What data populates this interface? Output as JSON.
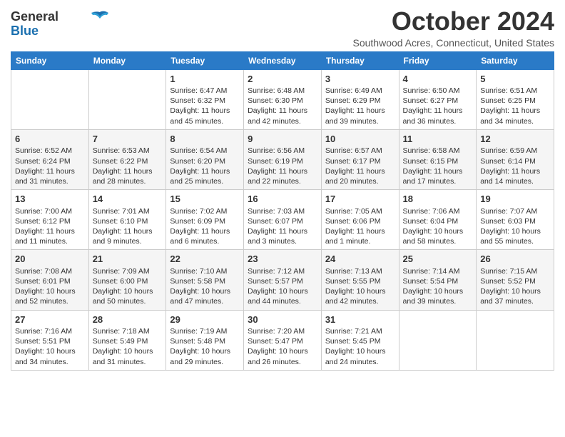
{
  "logo": {
    "general": "General",
    "blue": "Blue"
  },
  "header": {
    "month": "October 2024",
    "location": "Southwood Acres, Connecticut, United States"
  },
  "days_of_week": [
    "Sunday",
    "Monday",
    "Tuesday",
    "Wednesday",
    "Thursday",
    "Friday",
    "Saturday"
  ],
  "weeks": [
    [
      {
        "day": "",
        "info": ""
      },
      {
        "day": "",
        "info": ""
      },
      {
        "day": "1",
        "info": "Sunrise: 6:47 AM\nSunset: 6:32 PM\nDaylight: 11 hours\nand 45 minutes."
      },
      {
        "day": "2",
        "info": "Sunrise: 6:48 AM\nSunset: 6:30 PM\nDaylight: 11 hours\nand 42 minutes."
      },
      {
        "day": "3",
        "info": "Sunrise: 6:49 AM\nSunset: 6:29 PM\nDaylight: 11 hours\nand 39 minutes."
      },
      {
        "day": "4",
        "info": "Sunrise: 6:50 AM\nSunset: 6:27 PM\nDaylight: 11 hours\nand 36 minutes."
      },
      {
        "day": "5",
        "info": "Sunrise: 6:51 AM\nSunset: 6:25 PM\nDaylight: 11 hours\nand 34 minutes."
      }
    ],
    [
      {
        "day": "6",
        "info": "Sunrise: 6:52 AM\nSunset: 6:24 PM\nDaylight: 11 hours\nand 31 minutes."
      },
      {
        "day": "7",
        "info": "Sunrise: 6:53 AM\nSunset: 6:22 PM\nDaylight: 11 hours\nand 28 minutes."
      },
      {
        "day": "8",
        "info": "Sunrise: 6:54 AM\nSunset: 6:20 PM\nDaylight: 11 hours\nand 25 minutes."
      },
      {
        "day": "9",
        "info": "Sunrise: 6:56 AM\nSunset: 6:19 PM\nDaylight: 11 hours\nand 22 minutes."
      },
      {
        "day": "10",
        "info": "Sunrise: 6:57 AM\nSunset: 6:17 PM\nDaylight: 11 hours\nand 20 minutes."
      },
      {
        "day": "11",
        "info": "Sunrise: 6:58 AM\nSunset: 6:15 PM\nDaylight: 11 hours\nand 17 minutes."
      },
      {
        "day": "12",
        "info": "Sunrise: 6:59 AM\nSunset: 6:14 PM\nDaylight: 11 hours\nand 14 minutes."
      }
    ],
    [
      {
        "day": "13",
        "info": "Sunrise: 7:00 AM\nSunset: 6:12 PM\nDaylight: 11 hours\nand 11 minutes."
      },
      {
        "day": "14",
        "info": "Sunrise: 7:01 AM\nSunset: 6:10 PM\nDaylight: 11 hours\nand 9 minutes."
      },
      {
        "day": "15",
        "info": "Sunrise: 7:02 AM\nSunset: 6:09 PM\nDaylight: 11 hours\nand 6 minutes."
      },
      {
        "day": "16",
        "info": "Sunrise: 7:03 AM\nSunset: 6:07 PM\nDaylight: 11 hours\nand 3 minutes."
      },
      {
        "day": "17",
        "info": "Sunrise: 7:05 AM\nSunset: 6:06 PM\nDaylight: 11 hours\nand 1 minute."
      },
      {
        "day": "18",
        "info": "Sunrise: 7:06 AM\nSunset: 6:04 PM\nDaylight: 10 hours\nand 58 minutes."
      },
      {
        "day": "19",
        "info": "Sunrise: 7:07 AM\nSunset: 6:03 PM\nDaylight: 10 hours\nand 55 minutes."
      }
    ],
    [
      {
        "day": "20",
        "info": "Sunrise: 7:08 AM\nSunset: 6:01 PM\nDaylight: 10 hours\nand 52 minutes."
      },
      {
        "day": "21",
        "info": "Sunrise: 7:09 AM\nSunset: 6:00 PM\nDaylight: 10 hours\nand 50 minutes."
      },
      {
        "day": "22",
        "info": "Sunrise: 7:10 AM\nSunset: 5:58 PM\nDaylight: 10 hours\nand 47 minutes."
      },
      {
        "day": "23",
        "info": "Sunrise: 7:12 AM\nSunset: 5:57 PM\nDaylight: 10 hours\nand 44 minutes."
      },
      {
        "day": "24",
        "info": "Sunrise: 7:13 AM\nSunset: 5:55 PM\nDaylight: 10 hours\nand 42 minutes."
      },
      {
        "day": "25",
        "info": "Sunrise: 7:14 AM\nSunset: 5:54 PM\nDaylight: 10 hours\nand 39 minutes."
      },
      {
        "day": "26",
        "info": "Sunrise: 7:15 AM\nSunset: 5:52 PM\nDaylight: 10 hours\nand 37 minutes."
      }
    ],
    [
      {
        "day": "27",
        "info": "Sunrise: 7:16 AM\nSunset: 5:51 PM\nDaylight: 10 hours\nand 34 minutes."
      },
      {
        "day": "28",
        "info": "Sunrise: 7:18 AM\nSunset: 5:49 PM\nDaylight: 10 hours\nand 31 minutes."
      },
      {
        "day": "29",
        "info": "Sunrise: 7:19 AM\nSunset: 5:48 PM\nDaylight: 10 hours\nand 29 minutes."
      },
      {
        "day": "30",
        "info": "Sunrise: 7:20 AM\nSunset: 5:47 PM\nDaylight: 10 hours\nand 26 minutes."
      },
      {
        "day": "31",
        "info": "Sunrise: 7:21 AM\nSunset: 5:45 PM\nDaylight: 10 hours\nand 24 minutes."
      },
      {
        "day": "",
        "info": ""
      },
      {
        "day": "",
        "info": ""
      }
    ]
  ]
}
